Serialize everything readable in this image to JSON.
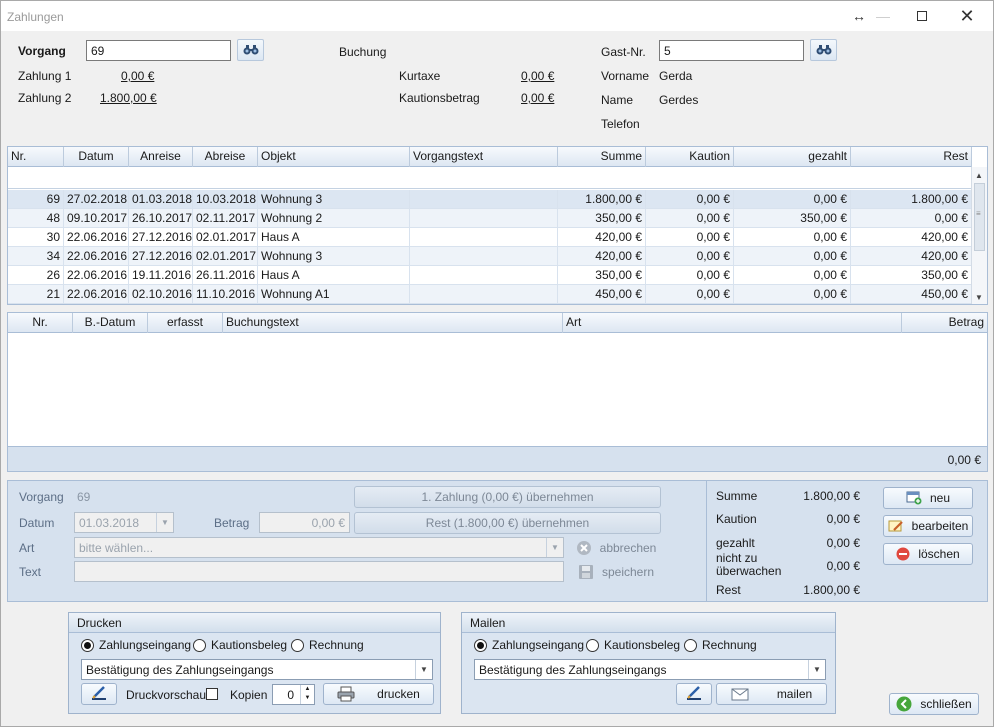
{
  "window": {
    "title": "Zahlungen"
  },
  "header": {
    "vorgang_label": "Vorgang",
    "vorgang_value": "69",
    "zahlung1_label": "Zahlung 1",
    "zahlung1_value": "0,00 €",
    "zahlung2_label": "Zahlung 2",
    "zahlung2_value": "1.800,00 €",
    "buchung_label": "Buchung",
    "kurtaxe_label": "Kurtaxe",
    "kurtaxe_value": "0,00 €",
    "kaution_label": "Kautionsbetrag",
    "kaution_value": "0,00 €",
    "gast_label": "Gast-Nr.",
    "gast_value": "5",
    "vorname_label": "Vorname",
    "vorname_value": "Gerda",
    "name_label": "Name",
    "name_value": "Gerdes",
    "telefon_label": "Telefon"
  },
  "bookings": {
    "columns": [
      "Nr.",
      "Datum",
      "Anreise",
      "Abreise",
      "Objekt",
      "Vorgangstext",
      "Summe",
      "Kaution",
      "gezahlt",
      "Rest"
    ],
    "rows": [
      {
        "nr": "69",
        "datum": "27.02.2018",
        "anreise": "01.03.2018",
        "abreise": "10.03.2018",
        "objekt": "Wohnung 3",
        "text": "",
        "summe": "1.800,00 €",
        "kaution": "0,00 €",
        "gezahlt": "0,00 €",
        "rest": "1.800,00 €"
      },
      {
        "nr": "48",
        "datum": "09.10.2017",
        "anreise": "26.10.2017",
        "abreise": "02.11.2017",
        "objekt": "Wohnung 2",
        "text": "",
        "summe": "350,00 €",
        "kaution": "0,00 €",
        "gezahlt": "350,00 €",
        "rest": "0,00 €"
      },
      {
        "nr": "30",
        "datum": "22.06.2016",
        "anreise": "27.12.2016",
        "abreise": "02.01.2017",
        "objekt": "Haus A",
        "text": "",
        "summe": "420,00 €",
        "kaution": "0,00 €",
        "gezahlt": "0,00 €",
        "rest": "420,00 €"
      },
      {
        "nr": "34",
        "datum": "22.06.2016",
        "anreise": "27.12.2016",
        "abreise": "02.01.2017",
        "objekt": "Wohnung 3",
        "text": "",
        "summe": "420,00 €",
        "kaution": "0,00 €",
        "gezahlt": "0,00 €",
        "rest": "420,00 €"
      },
      {
        "nr": "26",
        "datum": "22.06.2016",
        "anreise": "19.11.2016",
        "abreise": "26.11.2016",
        "objekt": "Haus A",
        "text": "",
        "summe": "350,00 €",
        "kaution": "0,00 €",
        "gezahlt": "0,00 €",
        "rest": "350,00 €"
      },
      {
        "nr": "21",
        "datum": "22.06.2016",
        "anreise": "02.10.2016",
        "abreise": "11.10.2016",
        "objekt": "Wohnung A1",
        "text": "",
        "summe": "450,00 €",
        "kaution": "0,00 €",
        "gezahlt": "0,00 €",
        "rest": "450,00 €"
      }
    ]
  },
  "payments": {
    "columns": [
      "Nr.",
      "B.-Datum",
      "erfasst",
      "Buchungstext",
      "Art",
      "Betrag"
    ],
    "total": "0,00 €"
  },
  "edit": {
    "vorgang_label": "Vorgang",
    "vorgang_value": "69",
    "datum_label": "Datum",
    "datum_value": "01.03.2018",
    "betrag_label": "Betrag",
    "betrag_value": "0,00 €",
    "art_label": "Art",
    "art_placeholder": "bitte wählen...",
    "text_label": "Text",
    "btn_zahlung1": "1. Zahlung (0,00 €) übernehmen",
    "btn_rest": "Rest (1.800,00 €) übernehmen",
    "btn_abbrechen": "abbrechen",
    "btn_speichern": "speichern"
  },
  "summary": {
    "summe_label": "Summe",
    "summe_value": "1.800,00 €",
    "kaution_label": "Kaution",
    "kaution_value": "0,00 €",
    "gezahlt_label": "gezahlt",
    "gezahlt_value": "0,00 €",
    "nicht_label_1": "nicht zu",
    "nicht_label_2": "überwachen",
    "nicht_value": "0,00 €",
    "rest_label": "Rest",
    "rest_value": "1.800,00 €"
  },
  "actions": {
    "neu": "neu",
    "bearbeiten": "bearbeiten",
    "loeschen": "löschen"
  },
  "drucken": {
    "title": "Drucken",
    "options": [
      "Zahlungseingang",
      "Kautionsbeleg",
      "Rechnung"
    ],
    "selected": "Zahlungseingang",
    "template": "Bestätigung des Zahlungseingangs",
    "vorschau_label": "Druckvorschau",
    "kopien_label": "Kopien",
    "kopien_value": "0",
    "btn": "drucken"
  },
  "mailen": {
    "title": "Mailen",
    "options": [
      "Zahlungseingang",
      "Kautionsbeleg",
      "Rechnung"
    ],
    "selected": "Zahlungseingang",
    "template": "Bestätigung des Zahlungseingangs",
    "btn": "mailen"
  },
  "footer": {
    "close": "schließen"
  },
  "colors": {
    "panel": "#d6e1ee",
    "grid_border": "#a9bdd6",
    "selected_row": "#dce6f2"
  }
}
